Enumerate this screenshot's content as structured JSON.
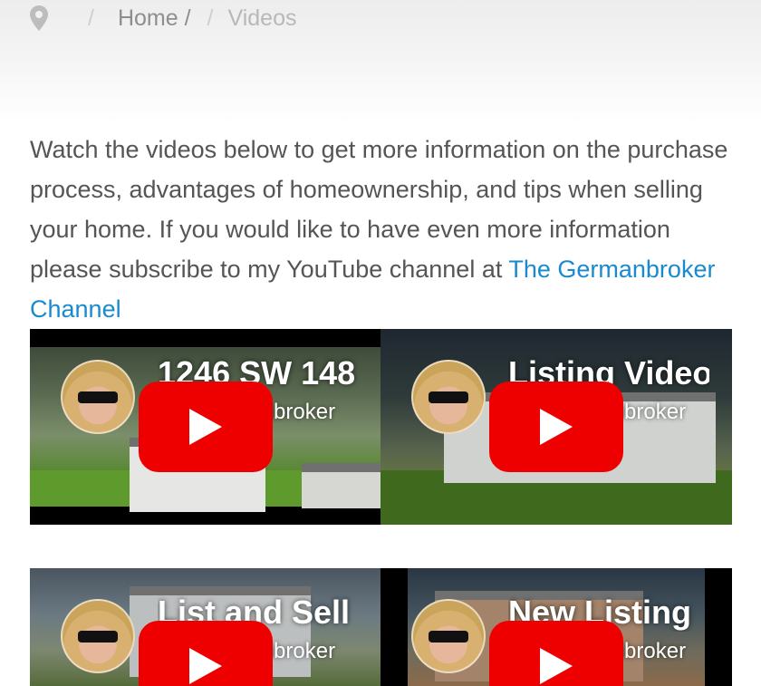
{
  "breadcrumb": {
    "icon": "location-pin-icon",
    "separator": "/",
    "home": "Home /",
    "current": "Videos"
  },
  "intro": {
    "text": "Watch the videos below to get more information on the purchase process, advantages of homeownership, and tips when selling your home. If you would like to have even more information please subscribe to my YouTube channel at ",
    "link_label": "The Germanbroker Channel"
  },
  "videos": [
    {
      "title": "1246 SW 148",
      "channel": "TheGermanbroker",
      "play_icon": "youtube-play-icon"
    },
    {
      "title": "Listing Video",
      "channel": "TheGermanbroker",
      "play_icon": "youtube-play-icon"
    },
    {
      "title": "List and Sell",
      "channel": "TheGermanbroker",
      "play_icon": "youtube-play-icon"
    },
    {
      "title": "New Listing",
      "channel": "TheGermanbroker",
      "play_icon": "youtube-play-icon"
    }
  ],
  "colors": {
    "link": "#1a8ad0",
    "text": "#555555",
    "play_button": "#ee0000"
  }
}
